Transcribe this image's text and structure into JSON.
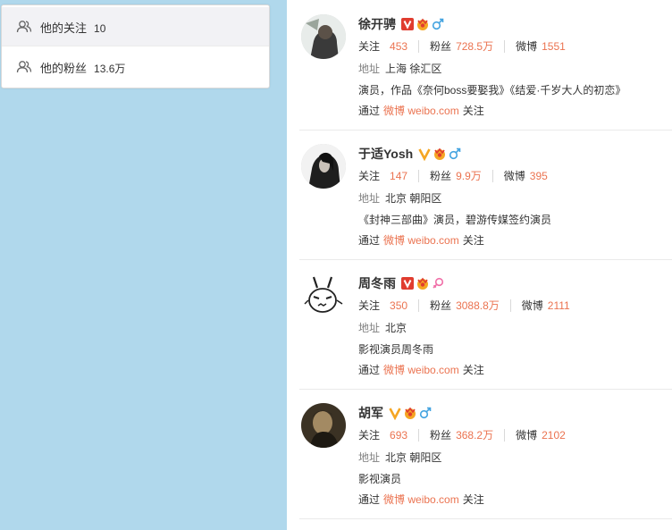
{
  "nav": {
    "items": [
      {
        "label": "他的关注",
        "count": "10",
        "icon": "users-icon"
      },
      {
        "label": "他的粉丝",
        "count": "13.6万",
        "icon": "users-icon"
      }
    ]
  },
  "colors": {
    "accent": "#eb7350",
    "background": "#b0d8ec",
    "vip_red": "#e03c2f",
    "verified_gold": "#f5a623",
    "male": "#43a3e0",
    "female": "#f06fa8"
  },
  "labels": {
    "follow": "关注",
    "fans": "粉丝",
    "weibo": "微博",
    "address": "地址",
    "via_prefix": "通过",
    "via_source": "微博 weibo.com",
    "via_suffix": "关注"
  },
  "users": [
    {
      "name": "徐开骋",
      "follow": "453",
      "fans": "728.5万",
      "weibo": "1551",
      "address": "上海 徐汇区",
      "desc": "演员，作品《奈何boss要娶我》《结爱·千岁大人的初恋》",
      "gender": "male",
      "badge": "vip"
    },
    {
      "name": "于适Yosh",
      "follow": "147",
      "fans": "9.9万",
      "weibo": "395",
      "address": "北京 朝阳区",
      "desc": "《封神三部曲》演员，碧游传媒签约演员",
      "gender": "male",
      "badge": "verified"
    },
    {
      "name": "周冬雨",
      "follow": "350",
      "fans": "3088.8万",
      "weibo": "2111",
      "address": "北京",
      "desc": "影视演员周冬雨",
      "gender": "female",
      "badge": "vip"
    },
    {
      "name": "胡军",
      "follow": "693",
      "fans": "368.2万",
      "weibo": "2102",
      "address": "北京 朝阳区",
      "desc": "影视演员",
      "gender": "male",
      "badge": "verified"
    }
  ]
}
